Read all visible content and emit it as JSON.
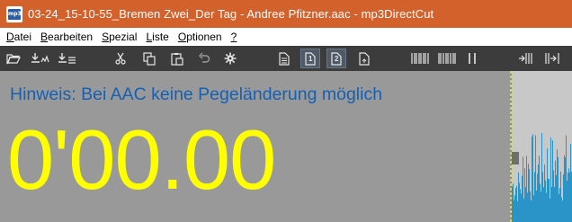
{
  "window": {
    "title": "03-24_15-10-55_Bremen Zwei_Der Tag - Andree Pfitzner.aac - mp3DirectCut",
    "app_icon": "mp3",
    "titlebar_color": "#d3612c"
  },
  "menu": [
    {
      "mnemonic": "D",
      "rest": "atei"
    },
    {
      "mnemonic": "B",
      "rest": "earbeiten"
    },
    {
      "mnemonic": "S",
      "rest": "pezial"
    },
    {
      "mnemonic": "L",
      "rest": "iste"
    },
    {
      "mnemonic": "O",
      "rest": "ptionen"
    },
    {
      "mnemonic": "?",
      "rest": ""
    }
  ],
  "toolbar": {
    "icons": [
      "open-folder-icon",
      "save-icon",
      "save-list-icon",
      "cut-icon",
      "copy-icon",
      "paste-icon",
      "undo-icon",
      "settings-gear-icon",
      "page-icon",
      "page-1-icon",
      "page-2-icon",
      "page-export-icon",
      "split-marker-icon",
      "multi-marker-icon",
      "pause-markers-icon",
      "move-start-icon",
      "move-end-icon"
    ],
    "page_1_label": "1",
    "page_2_label": "2"
  },
  "main": {
    "hint": "Hinweis: Bei AAC keine Pegeländerung möglich",
    "time": "0'00.00",
    "hint_color": "#1560b4",
    "time_color": "#ffff00",
    "background": "#999999"
  },
  "waveform": {
    "color": "#2a93c8"
  }
}
